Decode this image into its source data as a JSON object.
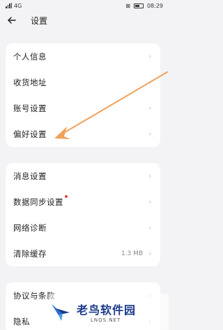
{
  "status_bar": {
    "network": "4G",
    "time": "08:29"
  },
  "header": {
    "title": "设置"
  },
  "group1": [
    {
      "label": "个人信息"
    },
    {
      "label": "收货地址"
    },
    {
      "label": "账号设置"
    },
    {
      "label": "偏好设置"
    }
  ],
  "group2": [
    {
      "label": "消息设置"
    },
    {
      "label": "数据同步设置",
      "badge": "red-dot"
    },
    {
      "label": "网络诊断"
    },
    {
      "label": "清除缓存",
      "value": "1.3 MB"
    }
  ],
  "group3": [
    {
      "label": "协议与条款"
    },
    {
      "label": "隐私"
    }
  ],
  "annotation": {
    "color": "#f0a25a"
  },
  "watermark": {
    "title": "老鸟软件园",
    "subtitle": "LNQS.NET"
  }
}
